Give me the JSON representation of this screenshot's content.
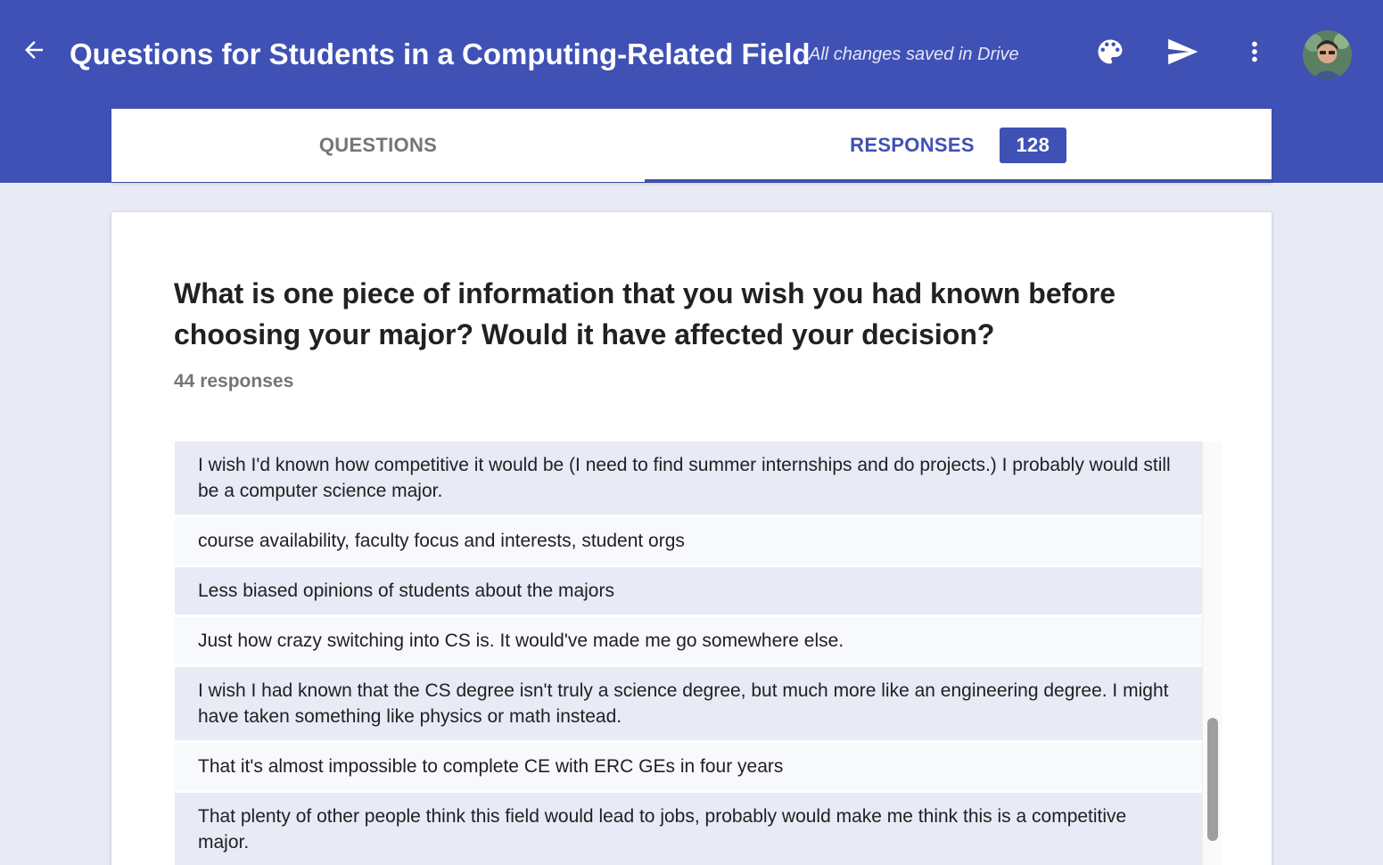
{
  "header": {
    "title": "Questions for Students in a Computing-Related Field",
    "save_status": "All changes saved in Drive",
    "icons": {
      "back": "arrow-back-icon",
      "palette": "palette-icon",
      "send": "send-icon",
      "more": "more-vert-icon"
    },
    "colors": {
      "primary": "#3f51b5",
      "background": "#e8eaf6"
    }
  },
  "tabs": {
    "questions_label": "QUESTIONS",
    "responses_label": "RESPONSES",
    "responses_count": "128",
    "active": "responses"
  },
  "question": {
    "text": "What is one piece of information that you wish you had known before choosing your major? Would it have affected your decision?",
    "response_count_text": "44 responses"
  },
  "responses": [
    "I wish I'd known how competitive it would be (I need to find summer internships and do projects.) I probably would still be a computer science major.",
    "course availability, faculty focus and interests, student orgs",
    "Less biased opinions of students about the majors",
    "Just how crazy switching into CS is. It would've made me go somewhere else.",
    "I wish I had known that the CS degree isn't truly a science degree, but much more like an engineering degree. I might have taken something like physics or math instead.",
    "That it's almost impossible to complete CE with ERC GEs in four years",
    "That plenty of other people think this field would lead to jobs, probably would make me think this is a competitive major."
  ]
}
